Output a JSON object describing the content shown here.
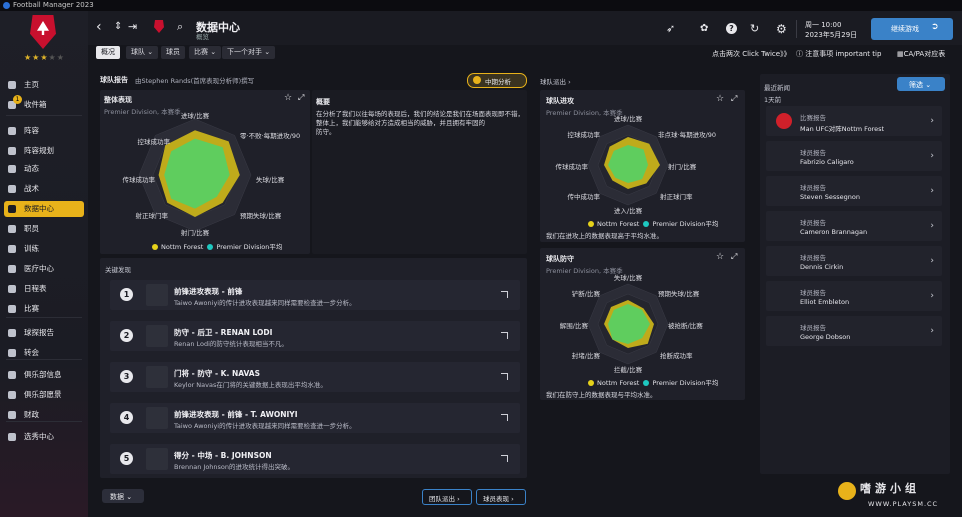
{
  "window": {
    "title": "Football Manager 2023"
  },
  "sidebar": {
    "items": [
      {
        "label": "主页"
      },
      {
        "label": "收件箱",
        "badge": "1"
      },
      {
        "label": "阵容"
      },
      {
        "label": "阵容规划"
      },
      {
        "label": "动态"
      },
      {
        "label": "战术"
      },
      {
        "label": "数据中心"
      },
      {
        "label": "职员"
      },
      {
        "label": "训练"
      },
      {
        "label": "医疗中心"
      },
      {
        "label": "日程表"
      },
      {
        "label": "比赛"
      },
      {
        "label": "球探报告"
      },
      {
        "label": "转会"
      },
      {
        "label": "俱乐部信息"
      },
      {
        "label": "俱乐部愿景"
      },
      {
        "label": "财政"
      },
      {
        "label": "选秀中心"
      }
    ]
  },
  "header": {
    "title": "数据中心",
    "subtitle": "概览",
    "date_line1": "周一 10:00",
    "date_line2": "2023年5月29日",
    "continue_label": "继续游戏"
  },
  "tabs": [
    {
      "label": "概况"
    },
    {
      "label": "球队 ⌄"
    },
    {
      "label": "球员"
    },
    {
      "label": "比赛 ⌄"
    },
    {
      "label": "下一个对手 ⌄"
    }
  ],
  "toolbar": {
    "click_twice": "点击两次 Click Twice》》",
    "important": "注意事项 important tip",
    "ca_pa": "CA/PA对应表"
  },
  "team_report": {
    "header": "球队报告",
    "by": "由Stephen Rands(首席表现分析师)撰写",
    "chip": "中期分析"
  },
  "overall": {
    "title": "整体表现",
    "sub": "Premier Division, 本赛季",
    "labels": [
      "进球/比赛",
      "零·不败·每期进攻/90",
      "失球/比赛",
      "预期失球/比赛",
      "射门/比赛",
      "射正球门率",
      "传球成功率",
      "控球成功率"
    ],
    "legend_a": "Nottm Forest",
    "legend_b": "Premier Division平均"
  },
  "summary": {
    "title": "概要",
    "text1": "在分析了我们以往每场的表现后，我们的结论是我们在场面表现即不错，",
    "text2": "整体上，我们能够给对方造成相当的威胁，并且拥有牢固的",
    "text3": "防守。"
  },
  "key_list": {
    "header": "关键发现",
    "items": [
      {
        "num": "1",
        "title": "前锋进攻表现 - 前锋",
        "desc": "Taiwo Awoniyi的传计进攻表现越来同样需要检查进一步分析。"
      },
      {
        "num": "2",
        "title": "防守 - 后卫 - RENAN LODI",
        "desc": "Renan Lodi的防守统计表现相当不凡。"
      },
      {
        "num": "3",
        "title": "门将 - 防守 - K. NAVAS",
        "desc": "Keylor Navas在门将的关键数据上表现出平均水准。"
      },
      {
        "num": "4",
        "title": "前锋进攻表现 - 前锋 - T. AWONIYI",
        "desc": "Taiwo Awoniyi的传计进攻表现越来同样需要检查进一步分析。"
      },
      {
        "num": "5",
        "title": "得分 - 中场 - B. JOHNSON",
        "desc": "Brennan Johnson的进攻统计得出突破。"
      }
    ]
  },
  "attack": {
    "section": "球队派出 ›",
    "title": "球队进攻",
    "sub": "Premier Division, 本赛季",
    "labels": [
      "进球/比赛",
      "非点球·每期进攻/90",
      "射门/比赛",
      "射正球门率",
      "进入/比赛",
      "传中成功率",
      "传球成功率",
      "控球成功率"
    ],
    "legend_a": "Nottm Forest",
    "legend_b": "Premier Division平均",
    "note": "我们在进攻上的数据表现高于平均水准。"
  },
  "defense": {
    "title": "球队防守",
    "sub": "Premier Division, 本赛季",
    "labels": [
      "失球/比赛",
      "预期失球/比赛",
      "被抢断/比赛",
      "抢断成功率",
      "拦截/比赛",
      "封堵/比赛",
      "解围/比赛",
      "铲断/比赛"
    ],
    "legend_a": "Nottm Forest",
    "legend_b": "Premier Division平均",
    "note": "我们在防守上的数据表现与平均水准。"
  },
  "news": {
    "title": "最近新闻",
    "sub": "1天前",
    "filter": "筛选 ⌄",
    "items": [
      {
        "label": "比赛报告",
        "name": "Man UFC对阵Nottm Forest"
      },
      {
        "label": "球员报告",
        "name": "Fabrizio Caligaro"
      },
      {
        "label": "球员报告",
        "name": "Steven Sessegnon"
      },
      {
        "label": "球员报告",
        "name": "Cameron Brannagan"
      },
      {
        "label": "球员报告",
        "name": "Dennis Cirkin"
      },
      {
        "label": "球员报告",
        "name": "Elliot Embleton"
      },
      {
        "label": "球员报告",
        "name": "George Dobson"
      }
    ]
  },
  "footer": {
    "left_btn": "数据 ⌄",
    "team_btn": "团队派出 ›",
    "player_btn": "球员表现 ›"
  },
  "watermark": "WWW.PLAYSM.CC",
  "colors": {
    "forest": "#c8b21a",
    "average": "#1ec8c0",
    "accent": "#e8b21a",
    "panel": "#1f2029"
  }
}
